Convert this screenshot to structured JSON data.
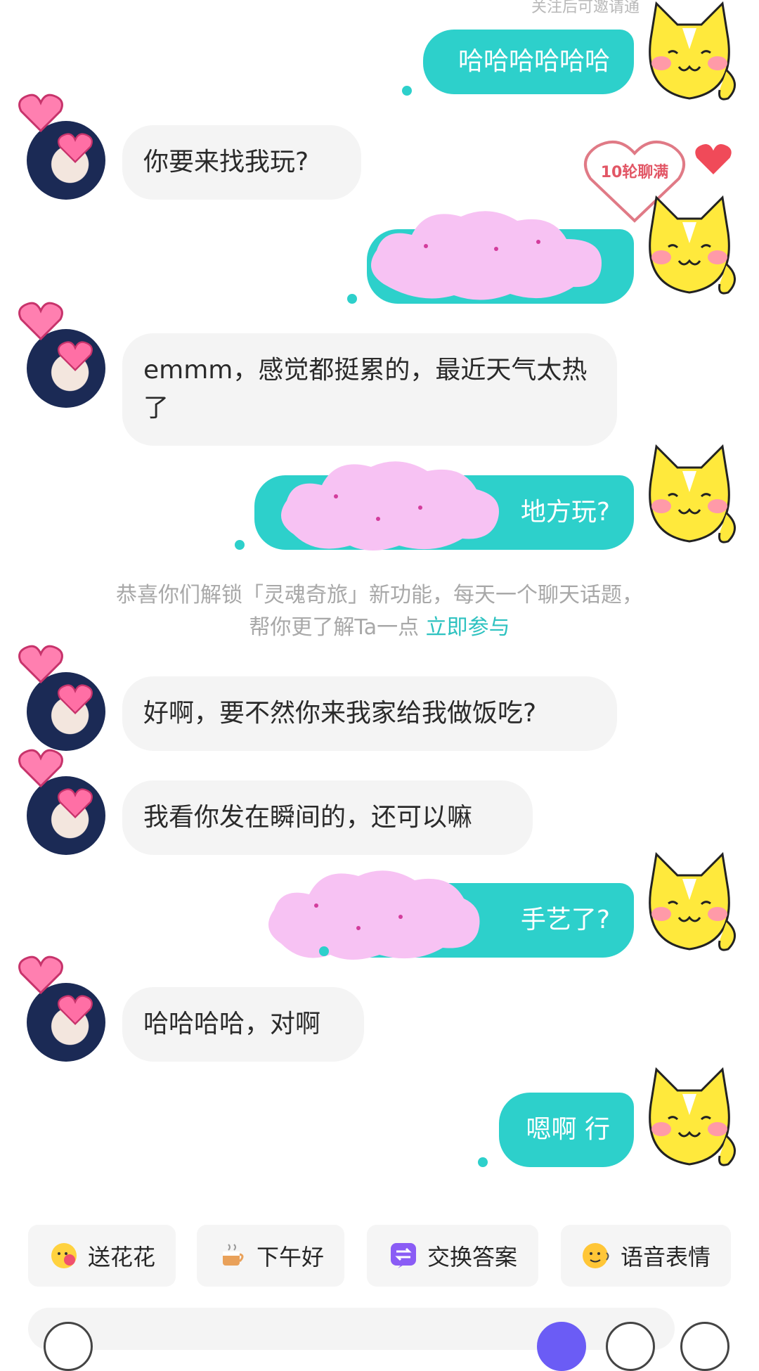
{
  "top_note": "关注后可邀请通",
  "colors": {
    "accent": "#2dd0cb",
    "incoming_bg": "#f4f4f4",
    "cloud": "#f7c2f3",
    "link": "#2dc2c0"
  },
  "badge": {
    "label": "10轮聊满"
  },
  "messages": [
    {
      "side": "out",
      "text": "哈哈哈哈哈哈"
    },
    {
      "side": "in",
      "text": "你要来找我玩?"
    },
    {
      "side": "out",
      "text": ""
    },
    {
      "side": "in",
      "text": "emmm，感觉都挺累的，最近天气太热了"
    },
    {
      "side": "out",
      "text": "地方玩?"
    },
    {
      "side": "in",
      "text": "好啊，要不然你来我家给我做饭吃?"
    },
    {
      "side": "in",
      "text": "我看你发在瞬间的，还可以嘛"
    },
    {
      "side": "out",
      "text": "手艺了?"
    },
    {
      "side": "in",
      "text": "哈哈哈哈，对啊"
    },
    {
      "side": "out",
      "text": "嗯啊 行"
    }
  ],
  "system_notice": {
    "line1": "恭喜你们解锁「灵魂奇旅」新功能，每天一个聊天话题，",
    "line2": "帮你更了解Ta一点",
    "link": "立即参与"
  },
  "quick_actions": [
    {
      "label": "送花花",
      "icon": "flower-emoji-icon"
    },
    {
      "label": "下午好",
      "icon": "coffee-cup-icon"
    },
    {
      "label": "交换答案",
      "icon": "exchange-icon"
    },
    {
      "label": "语音表情",
      "icon": "voice-emoji-icon"
    }
  ]
}
